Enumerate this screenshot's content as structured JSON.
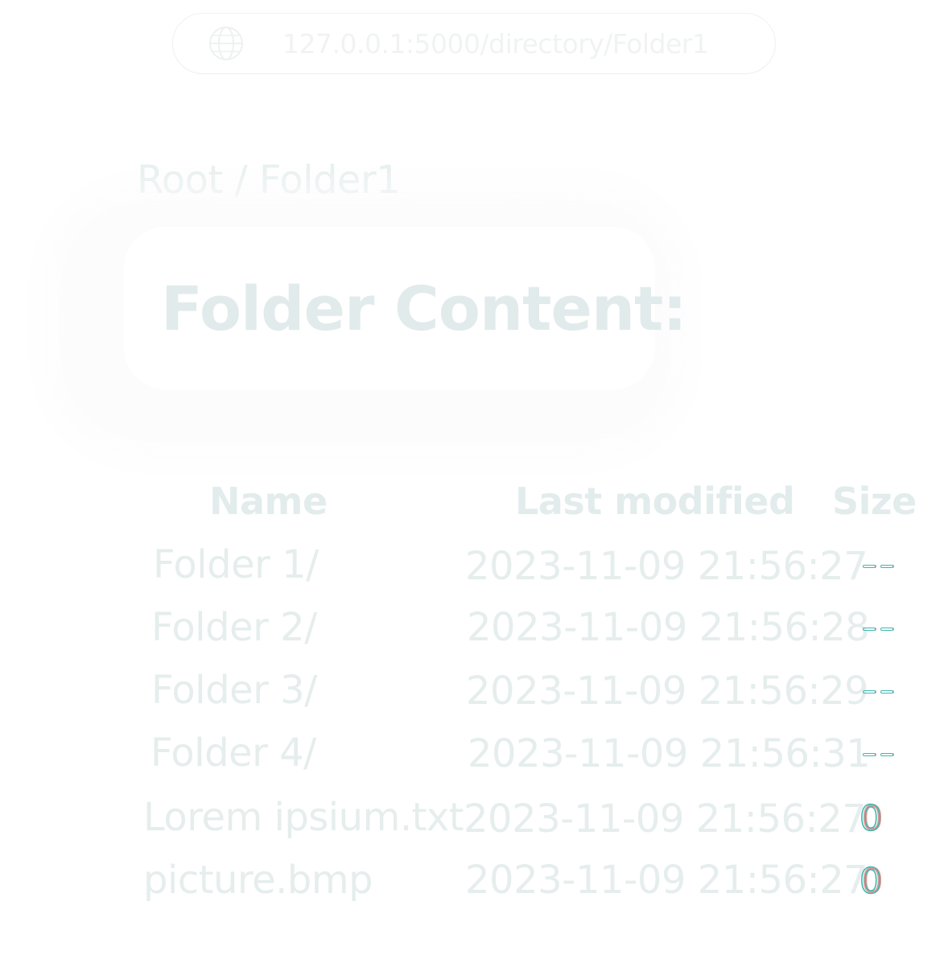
{
  "address_bar": {
    "url": "127.0.0.1:5000/directory/Folder1",
    "icon": "globe-icon"
  },
  "breadcrumb": "Root / Folder1",
  "title": "Folder Content:",
  "table": {
    "headers": {
      "name": "Name",
      "modified": "Last modified",
      "size": "Size"
    },
    "rows": [
      {
        "name": "Folder 1/",
        "modified": "2023-11-09 21:56:27",
        "size": "--"
      },
      {
        "name": "Folder 2/",
        "modified": "2023-11-09 21:56:28",
        "size": "--"
      },
      {
        "name": "Folder 3/",
        "modified": "2023-11-09 21:56:29",
        "size": "--"
      },
      {
        "name": "Folder 4/",
        "modified": "2023-11-09 21:56:31",
        "size": "--"
      },
      {
        "name": "Lorem ipsium.txt",
        "modified": "2023-11-09 21:56:27",
        "size": "0"
      },
      {
        "name": "picture.bmp",
        "modified": "2023-11-09 21:56:27",
        "size": "0"
      }
    ]
  },
  "colors": {
    "text_faint": "#e3ecec",
    "size_accent": "#3fb8b0",
    "size_fringe": "#dc3c3c"
  }
}
